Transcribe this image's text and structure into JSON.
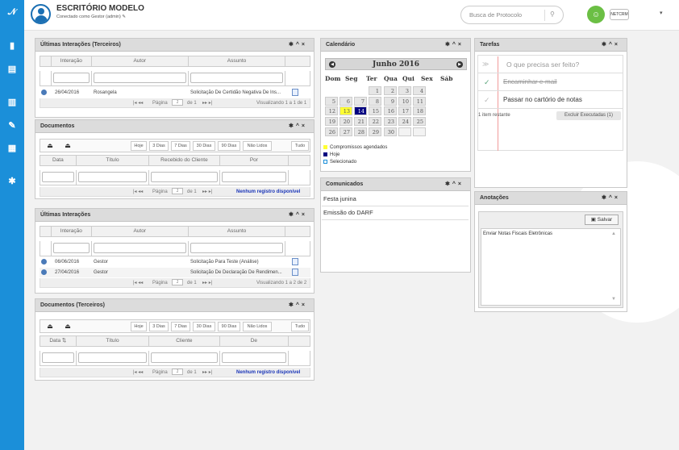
{
  "app": {
    "title": "ESCRITÓRIO MODELO",
    "subtitle": "Conectado como Gestor (admin)",
    "search_placeholder": "Busca de Protocolo",
    "brand": "NETCRM",
    "accent": "#1b8fd9"
  },
  "sidebar": {
    "icons": [
      "logo-icon",
      "document-icon",
      "list-icon",
      "chart-icon",
      "edit-icon",
      "calendar-icon",
      "gear-icon"
    ]
  },
  "panel_ui": {
    "title": "Últimas Interações (Terceiros)",
    "cols": [
      "Interação",
      "Autor",
      "Assunto"
    ],
    "rows": [
      {
        "date": "26/04/2016",
        "author": "Rosangela",
        "subject": "Solicitação De Certidão Negativa De Ins..."
      }
    ],
    "pager_label": "Página",
    "page": "1",
    "of": "de 1",
    "info": "Visualizando 1 a 1 de 1"
  },
  "toolbar": {
    "buttons": [
      "Hoje",
      "3 Dias",
      "7 Dias",
      "30 Dias",
      "90 Dias",
      "Não Lidos",
      "Tudo"
    ]
  },
  "panel_docs": {
    "title": "Documentos",
    "cols": [
      "Data",
      "Título",
      "Recebido do Cliente",
      "Por"
    ],
    "pager_label": "Página",
    "page": "1",
    "of": "de 1",
    "empty": "Nenhum registro disponível"
  },
  "panel_ui2": {
    "title": "Últimas Interações",
    "cols": [
      "Interação",
      "Autor",
      "Assunto"
    ],
    "rows": [
      {
        "date": "06/06/2016",
        "author": "Gestor",
        "subject": "Solicitação Para Teste (Análise)"
      },
      {
        "date": "27/04/2016",
        "author": "Gestor",
        "subject": "Solicitação De Declaração De Rendimen..."
      }
    ],
    "pager_label": "Página",
    "page": "1",
    "of": "de 1",
    "info": "Visualizando 1 a 2 de 2"
  },
  "panel_docs3": {
    "title": "Documentos (Terceiros)",
    "cols": [
      "Data",
      "Título",
      "Cliente",
      "De"
    ],
    "pager_label": "Página",
    "page": "1",
    "of": "de 1",
    "empty": "Nenhum registro disponível"
  },
  "calendar": {
    "title": "Calendário",
    "month": "Junho 2016",
    "dow": [
      "Dom",
      "Seg",
      "Ter",
      "Qua",
      "Qui",
      "Sex",
      "Sáb"
    ],
    "weeks": [
      [
        "",
        "",
        "",
        "1",
        "2",
        "3",
        "4"
      ],
      [
        "5",
        "6",
        "7",
        "8",
        "9",
        "10",
        "11"
      ],
      [
        "12",
        "13",
        "14",
        "15",
        "16",
        "17",
        "18"
      ],
      [
        "19",
        "20",
        "21",
        "22",
        "23",
        "24",
        "25"
      ],
      [
        "26",
        "27",
        "28",
        "29",
        "30",
        "",
        ""
      ]
    ],
    "appointment_day": "13",
    "today": "14",
    "legend": [
      "Compromissos agendados",
      "Hoje",
      "Selecionado"
    ],
    "colors": {
      "appointment": "#ffff33",
      "today": "#000080",
      "selected": "#ffffff"
    }
  },
  "comunicados": {
    "title": "Comunicados",
    "items": [
      "Festa junina",
      "Emissão do DARF"
    ]
  },
  "tarefas": {
    "title": "Tarefas",
    "placeholder": "O que precisa ser feito?",
    "items": [
      {
        "text": "Encaminhar e-mail",
        "done": true
      },
      {
        "text": "Passar no cartório de notas",
        "done": false
      }
    ],
    "remaining": "1 item restante",
    "clear": "Excluir Executadas (1)"
  },
  "anotacoes": {
    "title": "Anotações",
    "save": "Salvar",
    "text": "Enviar Notas Fiscais Eletrônicas"
  }
}
